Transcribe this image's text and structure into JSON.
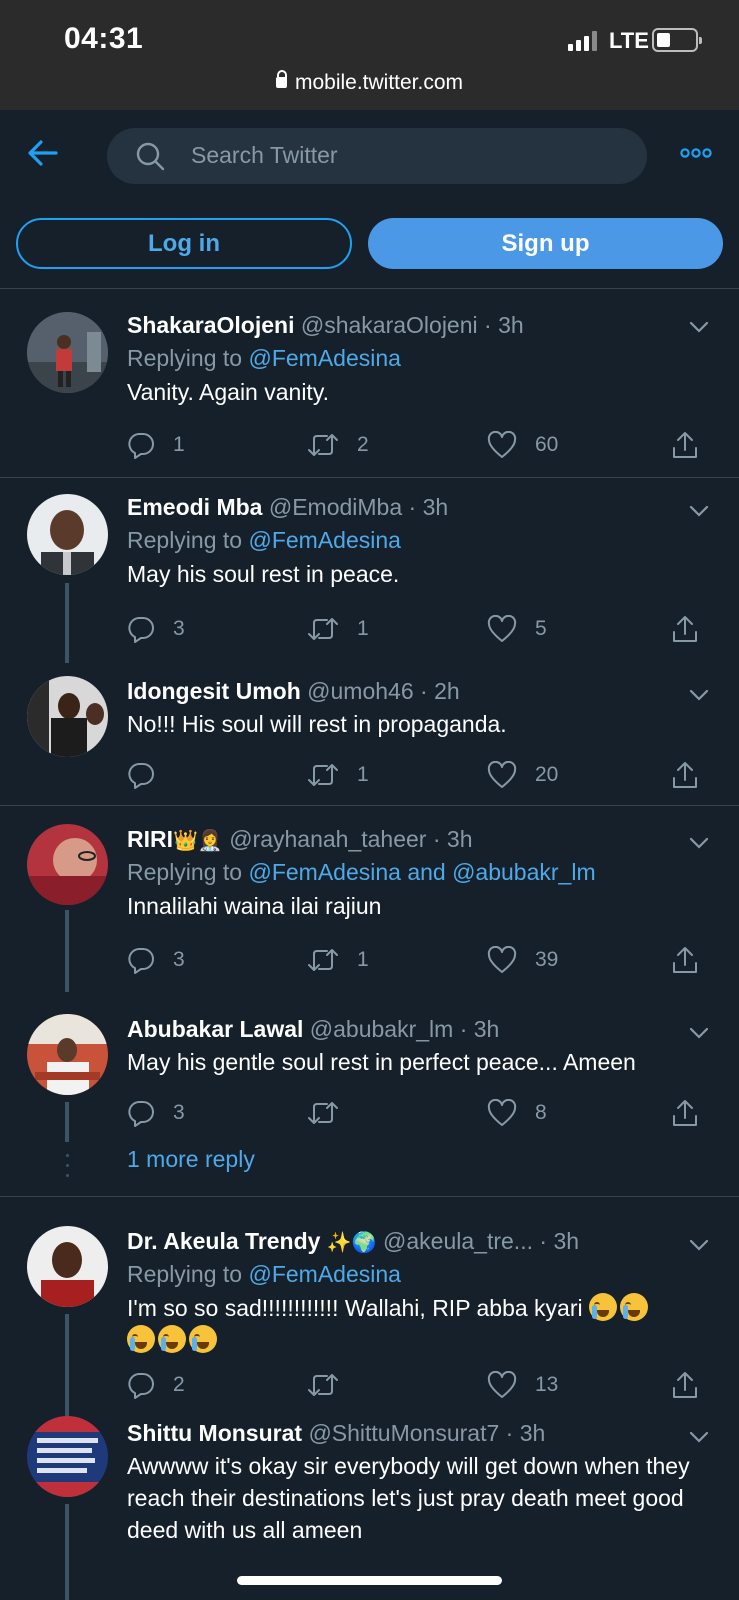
{
  "status_bar": {
    "time": "04:31",
    "network": "LTE",
    "url": "mobile.twitter.com"
  },
  "header": {
    "search_placeholder": "Search Twitter",
    "login_label": "Log in",
    "signup_label": "Sign up"
  },
  "icons": {
    "back": "arrow-left-icon",
    "search": "search-icon",
    "more": "more-dots-icon",
    "reply": "reply-icon",
    "retweet": "retweet-icon",
    "like": "heart-icon",
    "share": "share-icon"
  },
  "colors": {
    "background": "#15202b",
    "accent": "#1da1f2",
    "muted": "#8899a6",
    "divider": "#38444d"
  },
  "tweets": [
    {
      "name": "ShakaraOlojeni",
      "handle": "@shakaraOlojeni",
      "time": "3h",
      "replying_prefix": "Replying to",
      "replying_to": "@FemAdesina",
      "text": "Vanity. Again vanity.",
      "replies": "1",
      "retweets": "2",
      "likes": "60"
    },
    {
      "name": "Emeodi Mba",
      "handle": "@EmodiMba",
      "time": "3h",
      "replying_prefix": "Replying to",
      "replying_to": "@FemAdesina",
      "text": "May his soul rest in peace.",
      "replies": "3",
      "retweets": "1",
      "likes": "5"
    },
    {
      "name": "Idongesit Umoh",
      "handle": "@umoh46",
      "time": "2h",
      "text": "No!!! His soul will rest in propaganda.",
      "replies": "",
      "retweets": "1",
      "likes": "20"
    },
    {
      "name": "RIRI",
      "handle": "@rayhanah_taheer",
      "time": "3h",
      "replying_prefix": "Replying to",
      "replying_to": "@FemAdesina and @abubakr_lm",
      "text": "Innalilahi waina ilai rajiun",
      "replies": "3",
      "retweets": "1",
      "likes": "39"
    },
    {
      "name": "Abubakar Lawal",
      "handle": "@abubakr_lm",
      "time": "3h",
      "text": "May his gentle soul rest in perfect peace... Ameen",
      "replies": "3",
      "retweets": "",
      "likes": "8"
    },
    {
      "name": "Dr. Akeula Trendy",
      "handle": "@akeula_tre...",
      "time": "3h",
      "replying_prefix": "Replying to",
      "replying_to": "@FemAdesina",
      "text": "I'm so so sad!!!!!!!!!!!! Wallahi, RIP abba kyari",
      "replies": "2",
      "retweets": "",
      "likes": "13"
    },
    {
      "name": "Shittu Monsurat",
      "handle": "@ShittuMonsurat7",
      "time": "3h",
      "text": "Awwww it's okay sir everybody will get down when they reach their destinations let's just pray death meet good deed with us all ameen"
    }
  ],
  "more_reply_label": "1 more reply",
  "dot_separator": "·"
}
